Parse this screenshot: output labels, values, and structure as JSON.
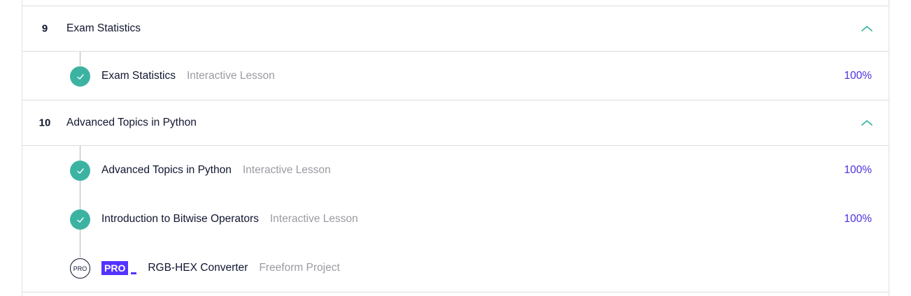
{
  "modules": [
    {
      "number": "9",
      "title": "Exam Statistics",
      "icon": "chevron-up-icon",
      "lessons": [
        {
          "title": "Exam Statistics",
          "type": "Interactive Lesson",
          "progress": "100%",
          "status": "completed"
        }
      ]
    },
    {
      "number": "10",
      "title": "Advanced Topics in Python",
      "icon": "chevron-up-icon",
      "lessons": [
        {
          "title": "Advanced Topics in Python",
          "type": "Interactive Lesson",
          "progress": "100%",
          "status": "completed"
        },
        {
          "title": "Introduction to Bitwise Operators",
          "type": "Interactive Lesson",
          "progress": "100%",
          "status": "completed"
        },
        {
          "title": "RGB-HEX Converter",
          "type": "Freeform Project",
          "status": "pro-locked",
          "badge": "PRO",
          "circle_label": "PRO"
        }
      ]
    }
  ],
  "colors": {
    "check_green": "#3cb3a2",
    "progress_purple": "#4b2fe0",
    "pro_badge": "#5533ff",
    "chevron_teal": "#3cb3a2"
  }
}
